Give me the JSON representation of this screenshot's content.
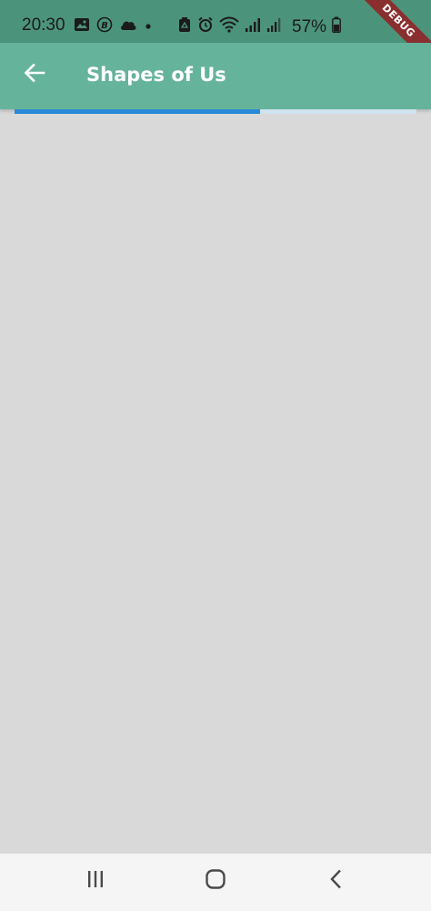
{
  "status_bar": {
    "time": "20:30",
    "battery_text": "57%",
    "icons_left": [
      "image-icon",
      "b-coin-icon",
      "cloud-icon",
      "dot-icon"
    ],
    "icons_right": [
      "alarm-clock-icon",
      "alarm-icon",
      "wifi-icon",
      "signal-icon",
      "signal-icon-2",
      "battery-icon"
    ]
  },
  "debug_banner": "DEBUG",
  "app_bar": {
    "title": "Shapes of Us",
    "back_icon": "arrow-back-icon"
  },
  "progress": {
    "value": 0.61,
    "color": "#2989d8"
  },
  "nav_bar": {
    "buttons": [
      "recent-apps-icon",
      "home-icon",
      "back-chevron-icon"
    ]
  },
  "colors": {
    "status_bar_bg": "#4c937b",
    "app_bar_bg": "#66b39c",
    "content_bg": "#d9d9d9",
    "nav_bar_bg": "#f5f5f5"
  }
}
